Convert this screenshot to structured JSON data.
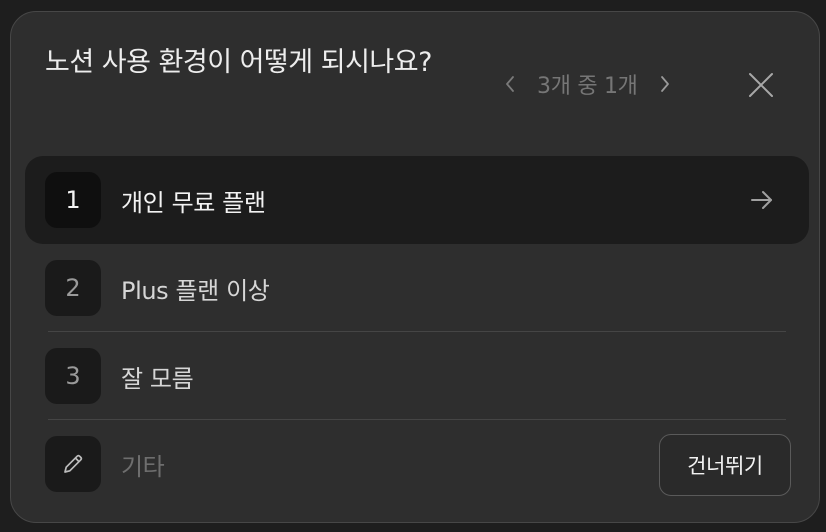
{
  "question": {
    "title": "노션 사용 환경이 어떻게 되시나요?"
  },
  "pager": {
    "count_label": "3개 중 1개"
  },
  "options": [
    {
      "number": "1",
      "label": "개인 무료 플랜",
      "selected": true
    },
    {
      "number": "2",
      "label": "Plus 플랜 이상",
      "selected": false
    },
    {
      "number": "3",
      "label": "잘 모름",
      "selected": false
    }
  ],
  "other": {
    "placeholder": "기타",
    "skip_label": "건너뛰기"
  },
  "icons": {
    "prev": "chevron-left-icon",
    "next": "chevron-right-icon",
    "close": "close-icon",
    "selected_arrow": "arrow-right-icon",
    "other": "pencil-icon"
  },
  "colors": {
    "card_background": "#2e2e2e",
    "selected_row": "#1c1c1c",
    "text_primary": "#ededed",
    "text_muted": "#767676"
  }
}
